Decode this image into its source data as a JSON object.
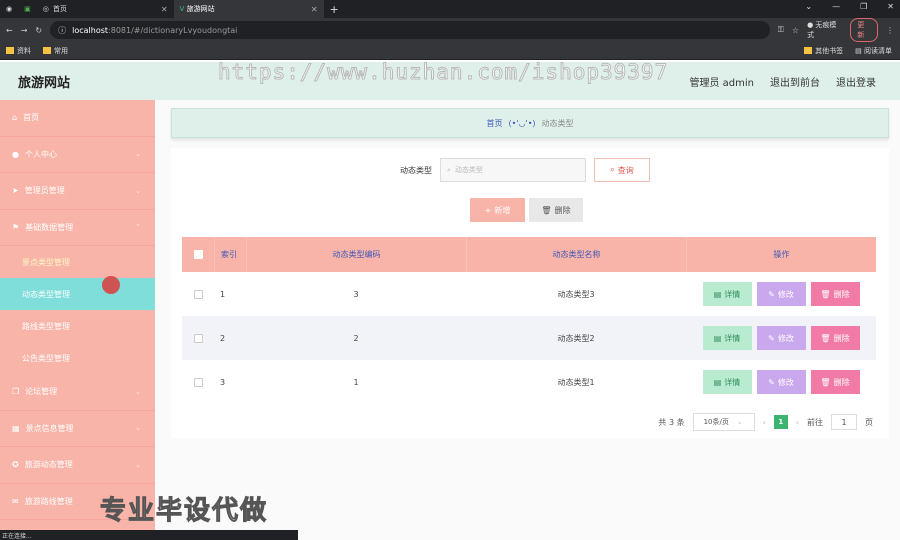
{
  "browser": {
    "tabs": [
      {
        "label": ""
      },
      {
        "label": "首页"
      },
      {
        "label": "旅游网站"
      }
    ],
    "new_tab": "+",
    "url_host": "localhost",
    "url_path": ":8081/#/dictionaryLvyoudongtai",
    "incognito": "无痕模式",
    "update": "更新",
    "bookmarks": [
      "资料",
      "常用"
    ],
    "bookmarks_right": [
      "其他书签",
      "阅读清单"
    ],
    "status": "正在连接..."
  },
  "header": {
    "logo": "旅游网站",
    "user": "管理员 admin",
    "front": "退出到前台",
    "logout": "退出登录"
  },
  "watermark": "https://www.huzhan.com/ishop39397",
  "sidebar": {
    "items": [
      {
        "label": "首页"
      },
      {
        "label": "个人中心"
      },
      {
        "label": "管理员管理"
      },
      {
        "label": "基础数据管理"
      }
    ],
    "subitems": [
      {
        "label": "景点类型管理"
      },
      {
        "label": "动态类型管理"
      },
      {
        "label": "路线类型管理"
      },
      {
        "label": "公告类型管理"
      }
    ],
    "more": [
      {
        "label": "论坛管理"
      },
      {
        "label": "景点信息管理"
      },
      {
        "label": "旅游动态管理"
      },
      {
        "label": "旅游路线管理"
      }
    ]
  },
  "breadcrumb": {
    "home": "首页",
    "sep": "(•'◡'•)",
    "current": "动态类型"
  },
  "search": {
    "label": "动态类型",
    "placeholder": "动态类型",
    "button": "查询"
  },
  "actions": {
    "add": "新增",
    "delete": "删除"
  },
  "table": {
    "columns": {
      "index": "索引",
      "code": "动态类型编码",
      "name": "动态类型名称",
      "ops": "操作"
    },
    "rows": [
      {
        "index": "1",
        "code": "3",
        "name": "动态类型3"
      },
      {
        "index": "2",
        "code": "2",
        "name": "动态类型2"
      },
      {
        "index": "3",
        "code": "1",
        "name": "动态类型1"
      }
    ],
    "btn_view": "详情",
    "btn_edit": "修改",
    "btn_delete": "删除"
  },
  "pager": {
    "total": "共 3 条",
    "size": "10条/页",
    "current": "1",
    "goto": "前往",
    "goto_value": "1",
    "page_unit": "页"
  },
  "overlay": "专业毕设代做"
}
